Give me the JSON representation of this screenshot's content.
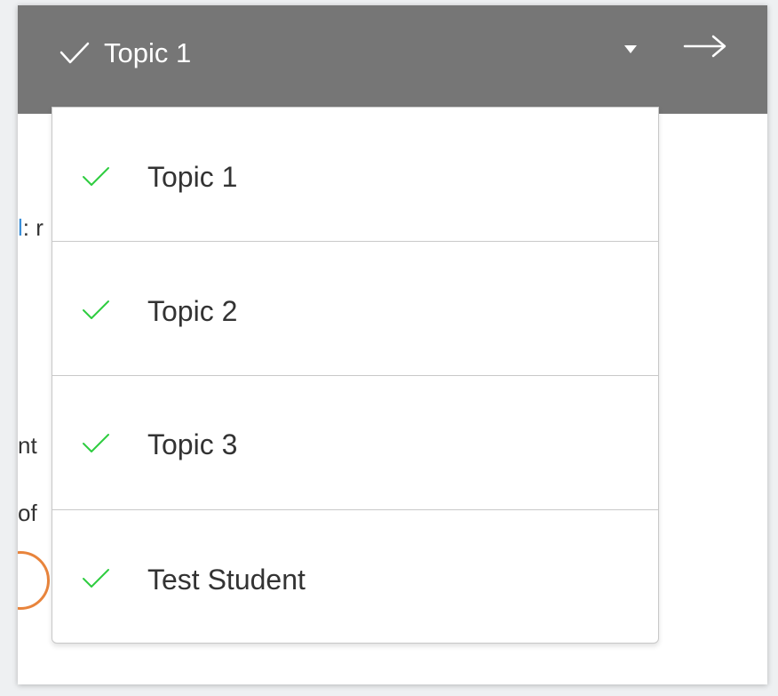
{
  "header": {
    "selected_label": "Topic 1",
    "check_icon": "check-icon",
    "dropdown_icon": "caret-down-icon",
    "next_icon": "arrow-right-icon"
  },
  "background": {
    "line1_link": "l",
    "line1_rest": ": r",
    "line2": "nt",
    "line3": "of"
  },
  "dropdown": {
    "items": [
      {
        "label": "Topic 1",
        "icon": "check-icon"
      },
      {
        "label": "Topic 2",
        "icon": "check-icon"
      },
      {
        "label": "Topic 3",
        "icon": "check-icon"
      },
      {
        "label": "Test Student",
        "icon": "check-icon"
      }
    ]
  },
  "colors": {
    "header_bg": "#767676",
    "check_green": "#2ecc40",
    "link_blue": "#3b8fd8",
    "accent_orange": "#e8843c"
  }
}
